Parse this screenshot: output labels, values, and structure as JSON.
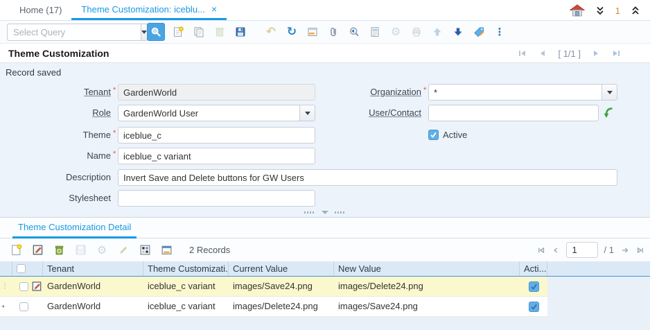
{
  "app": {
    "tabs": [
      {
        "label": "Home (17)"
      },
      {
        "label": "Theme Customization: iceblu...",
        "close": "×"
      }
    ],
    "window_controls": {
      "desktop_count": "1"
    }
  },
  "toolbar": {
    "select_query": {
      "placeholder": "Select Query"
    },
    "icons": [
      "find",
      "new-record",
      "copy-record",
      "delete-record",
      "save",
      "undo",
      "requery",
      "toggle-grid",
      "attachment",
      "zoom-across",
      "report",
      "process",
      "print",
      "parent-record",
      "detail-record",
      "label",
      "more-options"
    ]
  },
  "panel": {
    "title": "Theme Customization",
    "record_navigation": "[ 1/1 ]",
    "status_message": "Record saved"
  },
  "form": {
    "required_marker": "*",
    "tenant": {
      "label": "Tenant",
      "value": "GardenWorld",
      "required": true
    },
    "organization": {
      "label": "Organization",
      "value": "*",
      "required": true
    },
    "role": {
      "label": "Role",
      "value": "GardenWorld User"
    },
    "user_contact": {
      "label": "User/Contact",
      "value": ""
    },
    "theme": {
      "label": "Theme",
      "value": "iceblue_c",
      "required": true
    },
    "active": {
      "label": "Active",
      "checked": true
    },
    "name": {
      "label": "Name",
      "value": "iceblue_c variant",
      "required": true
    },
    "description": {
      "label": "Description",
      "value": "Invert Save and Delete buttons for GW Users"
    },
    "stylesheet": {
      "label": "Stylesheet",
      "value": ""
    }
  },
  "detail": {
    "tab_label": "Theme Customization Detail",
    "records_count": "2 Records",
    "toolbar_icons": [
      "new-row",
      "edit-row",
      "delete-row",
      "save-row",
      "process-row",
      "ignore-row",
      "customize-grid",
      "toggle-detail-layout"
    ],
    "pagination": {
      "current_page": "1",
      "total_label": "/ 1"
    },
    "table": {
      "columns": [
        "Tenant",
        "Theme Customizati...",
        "Current Value",
        "New Value",
        "Acti..."
      ],
      "rows": [
        {
          "tenant": "GardenWorld",
          "theme_customization": "iceblue_c variant",
          "current_value": "images/Save24.png",
          "new_value": "images/Delete24.png",
          "active": true,
          "selected": true
        },
        {
          "tenant": "GardenWorld",
          "theme_customization": "iceblue_c variant",
          "current_value": "images/Delete24.png",
          "new_value": "images/Save24.png",
          "active": true,
          "selected": false
        }
      ]
    }
  },
  "colors": {
    "accent_blue": "#1899e3",
    "selected_row_yellow": "#fbf8cd",
    "table_header_bg": "#dbe9f7",
    "required_red": "#e4504e",
    "checkbox_blue": "#5fb0e8"
  }
}
